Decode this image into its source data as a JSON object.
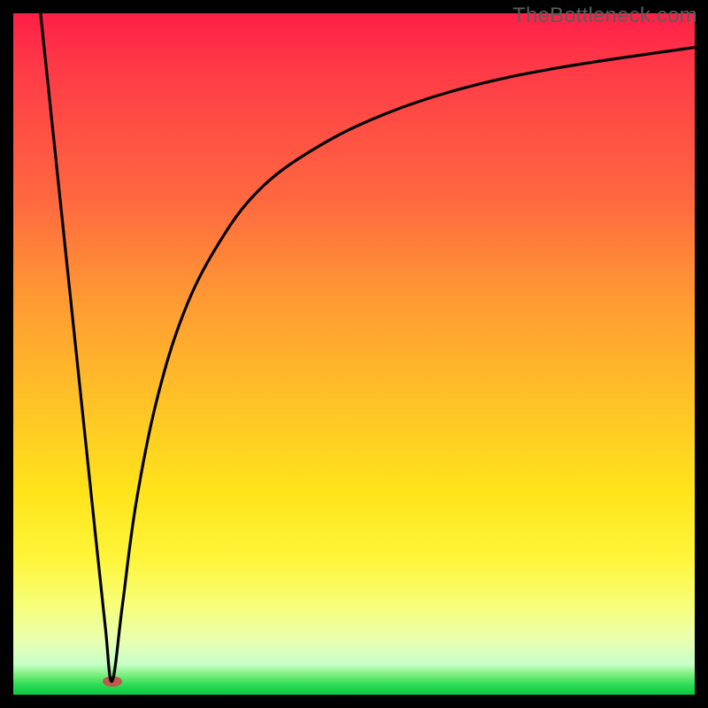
{
  "watermark": "TheBottleneck.com",
  "colors": {
    "background": "#000000",
    "curve": "#000000",
    "bump": "#c0594c",
    "gradient_top": "#ff1f47",
    "gradient_bottom": "#0cc93c"
  },
  "chart_data": {
    "type": "line",
    "title": "",
    "xlabel": "",
    "ylabel": "",
    "xlim": [
      0,
      100
    ],
    "ylim": [
      0,
      100
    ],
    "note": "Axes are unlabeled; values normalized 0-100. y=0 at bottom (green), y=100 at top (red). Two curve branches meet at the minimum near x≈14.5, y≈2.",
    "minimum_point": {
      "x": 14.5,
      "y": 2
    },
    "series": [
      {
        "name": "left-branch",
        "description": "steep near-linear descent from top-left to the minimum",
        "x": [
          4.0,
          6.0,
          8.0,
          10.0,
          12.0,
          13.5,
          14.5
        ],
        "y": [
          100,
          81,
          62,
          43,
          24,
          10,
          2
        ]
      },
      {
        "name": "right-branch",
        "description": "rises from the minimum and asymptotically flattens toward upper-right",
        "x": [
          14.5,
          16,
          18,
          21,
          25,
          30,
          36,
          44,
          54,
          66,
          80,
          100
        ],
        "y": [
          2,
          13,
          28,
          43,
          56,
          66,
          74,
          80,
          85,
          89,
          92,
          95
        ]
      }
    ],
    "marker": {
      "shape": "ellipse",
      "position": {
        "x": 14.5,
        "y": 2
      },
      "color": "#c0594c"
    }
  }
}
